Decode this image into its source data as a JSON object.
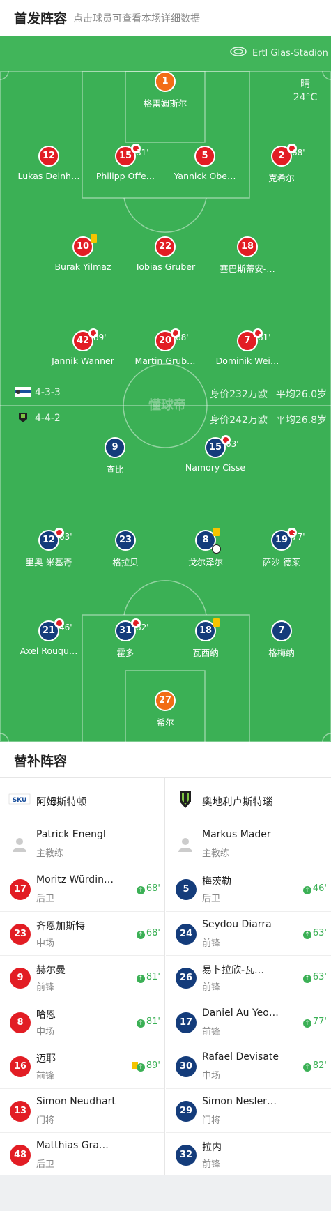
{
  "header": {
    "title": "首发阵容",
    "subtitle": "点击球员可查看本场详细数据"
  },
  "venue": {
    "name": "Ertl Glas-Stadion",
    "weather": "晴",
    "temperature": "24°C"
  },
  "watermark": "懂球帝",
  "home_team": {
    "formation": "4-3-3",
    "market_value": "身价232万欧",
    "avg_age": "平均26.0岁",
    "players": [
      {
        "number": "1",
        "name": "格雷姆斯尔",
        "color": "orange"
      },
      {
        "number": "12",
        "name": "Lukas Deinh…",
        "color": "red"
      },
      {
        "number": "15",
        "name": "Philipp Offe…",
        "color": "red",
        "sub": "81'"
      },
      {
        "number": "5",
        "name": "Yannick Obe…",
        "color": "red"
      },
      {
        "number": "2",
        "name": "克希尔",
        "color": "red",
        "sub": "68'"
      },
      {
        "number": "10",
        "name": "Burak Yilmaz",
        "color": "red",
        "yellow": true
      },
      {
        "number": "22",
        "name": "Tobias Gruber",
        "color": "red"
      },
      {
        "number": "18",
        "name": "塞巴斯蒂安-…",
        "color": "red"
      },
      {
        "number": "42",
        "name": "Jannik Wanner",
        "color": "red",
        "sub": "89'"
      },
      {
        "number": "20",
        "name": "Martin Grub…",
        "color": "red",
        "sub": "68'"
      },
      {
        "number": "7",
        "name": "Dominik Wei…",
        "color": "red",
        "sub": "81'"
      }
    ]
  },
  "away_team": {
    "formation": "4-4-2",
    "market_value": "身价242万欧",
    "avg_age": "平均26.8岁",
    "players": [
      {
        "number": "9",
        "name": "查比",
        "color": "blue"
      },
      {
        "number": "15",
        "name": "Namory Cisse",
        "color": "blue",
        "sub": "63'"
      },
      {
        "number": "12",
        "name": "里奥-米基奇",
        "color": "blue",
        "sub": "63'"
      },
      {
        "number": "23",
        "name": "格拉贝",
        "color": "blue"
      },
      {
        "number": "8",
        "name": "戈尔泽尔",
        "color": "blue",
        "yellow": true,
        "goal": true
      },
      {
        "number": "19",
        "name": "萨沙-德莱",
        "color": "blue",
        "sub": "77'"
      },
      {
        "number": "21",
        "name": "Axel Rouqu…",
        "color": "blue",
        "sub": "46'"
      },
      {
        "number": "31",
        "name": "霍多",
        "color": "blue",
        "sub": "82'"
      },
      {
        "number": "18",
        "name": "瓦西纳",
        "color": "blue",
        "yellow": true
      },
      {
        "number": "7",
        "name": "格梅纳",
        "color": "blue"
      },
      {
        "number": "27",
        "name": "希尔",
        "color": "orange"
      }
    ]
  },
  "subs": {
    "title": "替补阵容",
    "left": {
      "team": "阿姆斯特顿",
      "coach": {
        "name": "Patrick Enengl",
        "role": "主教练"
      },
      "players": [
        {
          "number": "17",
          "name": "Moritz Würdin…",
          "pos": "后卫",
          "min": "68'"
        },
        {
          "number": "23",
          "name": "齐恩加斯特",
          "pos": "中场",
          "min": "68'"
        },
        {
          "number": "9",
          "name": "赫尔曼",
          "pos": "前锋",
          "min": "81'"
        },
        {
          "number": "8",
          "name": "哈恩",
          "pos": "中场",
          "min": "81'"
        },
        {
          "number": "16",
          "name": "迈耶",
          "pos": "前锋",
          "min": "89'",
          "yellow": true
        },
        {
          "number": "13",
          "name": "Simon Neudhart",
          "pos": "门将",
          "min": ""
        },
        {
          "number": "48",
          "name": "Matthias Gra…",
          "pos": "后卫",
          "min": ""
        }
      ]
    },
    "right": {
      "team": "奥地利卢斯特瑙",
      "coach": {
        "name": "Markus Mader",
        "role": "主教练"
      },
      "players": [
        {
          "number": "5",
          "name": "梅茨勒",
          "pos": "后卫",
          "min": "46'"
        },
        {
          "number": "24",
          "name": "Seydou Diarra",
          "pos": "前锋",
          "min": "63'"
        },
        {
          "number": "26",
          "name": "易卜拉欣-瓦…",
          "pos": "前锋",
          "min": "63'"
        },
        {
          "number": "17",
          "name": "Daniel Au Yeo…",
          "pos": "前锋",
          "min": "77'"
        },
        {
          "number": "30",
          "name": "Rafael Devisate",
          "pos": "中场",
          "min": "82'"
        },
        {
          "number": "29",
          "name": "Simon Nesler…",
          "pos": "门将",
          "min": ""
        },
        {
          "number": "32",
          "name": "拉内",
          "pos": "前锋",
          "min": ""
        }
      ]
    }
  }
}
